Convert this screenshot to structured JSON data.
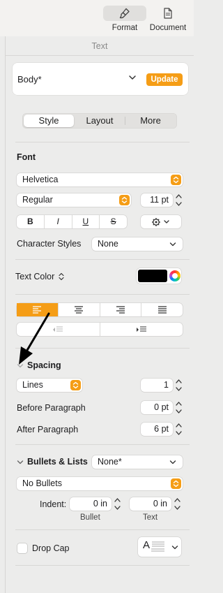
{
  "toolbar": {
    "format_label": "Format",
    "document_label": "Document"
  },
  "panel": {
    "title": "Text",
    "paragraph_style": "Body*",
    "update_label": "Update",
    "tabs": [
      "Style",
      "Layout",
      "More"
    ],
    "active_tab": "Style"
  },
  "font": {
    "heading": "Font",
    "family": "Helvetica",
    "typeface": "Regular",
    "size": "11 pt",
    "styles": [
      "B",
      "I",
      "U",
      "S"
    ],
    "character_styles_label": "Character Styles",
    "character_styles_value": "None"
  },
  "text_color": {
    "label": "Text Color",
    "value": "#000000"
  },
  "alignment": {
    "options": [
      "align-left-icon",
      "align-center-icon",
      "align-right-icon",
      "justify-icon"
    ],
    "active": "align-left-icon",
    "indent_decrease_icon": "decrease-indent-icon",
    "indent_increase_icon": "increase-indent-icon"
  },
  "spacing": {
    "heading": "Spacing",
    "line_mode": "Lines",
    "line_value": "1",
    "before_label": "Before Paragraph",
    "before_value": "0 pt",
    "after_label": "After Paragraph",
    "after_value": "6 pt"
  },
  "bullets": {
    "heading": "Bullets & Lists",
    "list_style": "None*",
    "bullet_type": "No Bullets",
    "indent_label": "Indent:",
    "bullet_indent": "0 in",
    "text_indent": "0 in",
    "bullet_caption": "Bullet",
    "text_caption": "Text"
  },
  "drop_cap": {
    "label": "Drop Cap",
    "checked": false,
    "preview_letter": "A"
  },
  "colors": {
    "accent": "#f59d16",
    "panel_bg": "#ececeb",
    "annotation_arrow": "#000000"
  }
}
